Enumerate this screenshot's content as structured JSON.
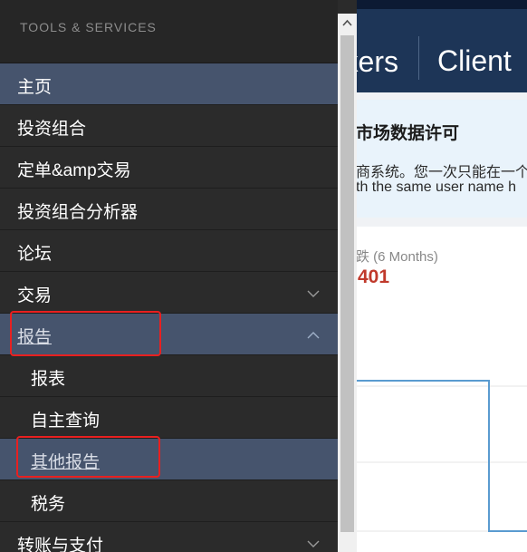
{
  "background_page": {
    "header_left_text": "kers",
    "header_right_text": "Client",
    "notice_title": "市场数据许可",
    "notice_line1": "商系统。您一次只能在一个",
    "notice_line2": "th the same user name h",
    "stat_label": "跌 (6 Months)",
    "stat_value": "401"
  },
  "sidebar": {
    "title": "TOOLS & SERVICES",
    "items": [
      {
        "label": "主页",
        "level": "top",
        "active": true
      },
      {
        "label": "投资组合",
        "level": "top"
      },
      {
        "label": "定单&amp交易",
        "level": "top"
      },
      {
        "label": "投资组合分析器",
        "level": "top"
      },
      {
        "label": "论坛",
        "level": "top"
      },
      {
        "label": "交易",
        "level": "top",
        "chevron": "down"
      },
      {
        "label": "报告",
        "level": "top",
        "chevron": "up",
        "active": true,
        "linked": true
      },
      {
        "label": "报表",
        "level": "sub"
      },
      {
        "label": "自主查询",
        "level": "sub"
      },
      {
        "label": "其他报告",
        "level": "sub",
        "active": true,
        "linked": true
      },
      {
        "label": "税务",
        "level": "sub"
      },
      {
        "label": "转账与支付",
        "level": "top",
        "chevron": "down"
      }
    ]
  },
  "colors": {
    "sidebar_bg": "#2b2b2b",
    "active_bg": "#46546d",
    "highlight": "#e82020",
    "header_bg": "#1d3557",
    "stat_red": "#c0392b",
    "chart_line": "#5a9bd0"
  },
  "icons": {
    "chevron_down": "chevron-down-icon",
    "chevron_up": "chevron-up-icon",
    "scroll_up": "scroll-up-arrow-icon"
  }
}
